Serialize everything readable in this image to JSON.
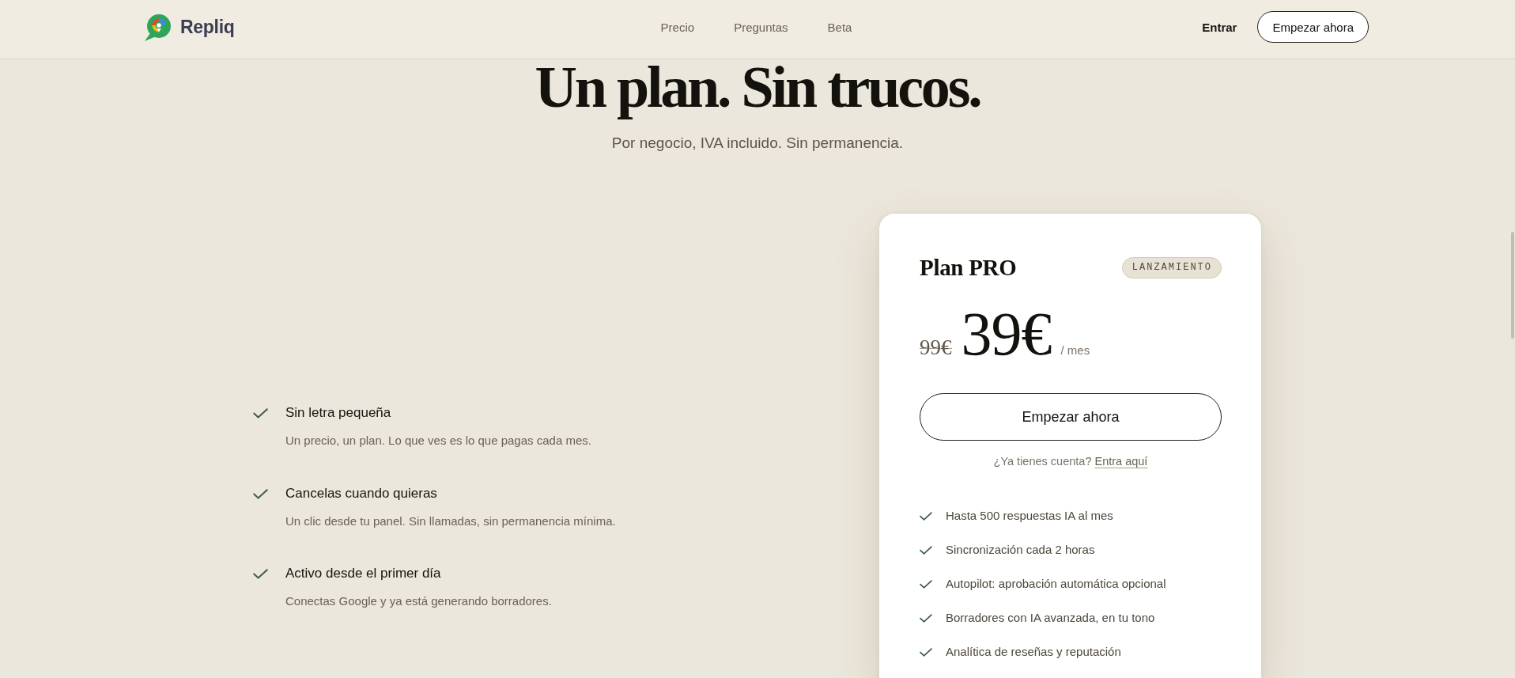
{
  "header": {
    "brand": "Repliq",
    "nav": [
      {
        "label": "Precio"
      },
      {
        "label": "Preguntas"
      },
      {
        "label": "Beta"
      }
    ],
    "login": "Entrar",
    "cta": "Empezar ahora"
  },
  "hero": {
    "title": "Un plan. Sin trucos.",
    "subtitle": "Por negocio, IVA incluido. Sin permanencia."
  },
  "benefits": [
    {
      "title": "Sin letra pequeña",
      "description": "Un precio, un plan. Lo que ves es lo que pagas cada mes."
    },
    {
      "title": "Cancelas cuando quieras",
      "description": "Un clic desde tu panel. Sin llamadas, sin permanencia mínima."
    },
    {
      "title": "Activo desde el primer día",
      "description": "Conectas Google y ya está generando borradores."
    }
  ],
  "plan": {
    "name": "Plan PRO",
    "badge": "LANZAMIENTO",
    "old_price": "99€",
    "price": "39€",
    "period": "/ mes",
    "cta": "Empezar ahora",
    "login_prompt": "¿Ya tienes cuenta?",
    "login_link": "Entra aquí",
    "features": [
      "Hasta 500 respuestas IA al mes",
      "Sincronización cada 2 horas",
      "Autopilot: aprobación automática opcional",
      "Borradores con IA avanzada, en tu tono",
      "Analítica de reseñas y reputación"
    ]
  }
}
